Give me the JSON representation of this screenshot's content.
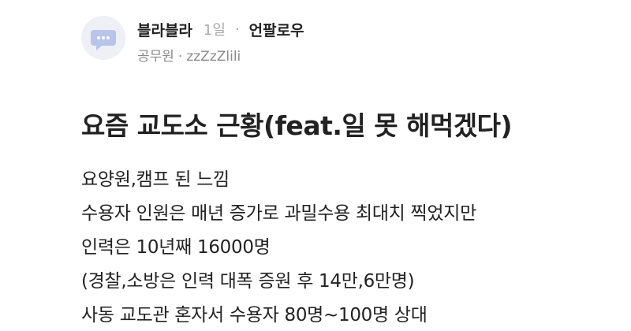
{
  "post": {
    "author": {
      "name": "블라블라",
      "time": "1일",
      "separator": "·",
      "follow_label": "언팔로우",
      "job": "공무원",
      "job_separator": "·",
      "nickname": "zzZzZlili",
      "avatar_icon": "speech-bubble-icon",
      "avatar_color": "#b8c4ea"
    },
    "title": "요즘 교도소 근황(feat.일 못 해먹겠다)",
    "body_lines": [
      "요양원,캠프 된 느낌",
      "수용자 인원은 매년 증가로 과밀수용 최대치 찍었지만",
      "인력은 10년째 16000명",
      "(경찰,소방은 인력 대폭 증원 후 14만,6만명)",
      "사동 교도관 혼자서 수용자 80명~100명 상대"
    ]
  }
}
